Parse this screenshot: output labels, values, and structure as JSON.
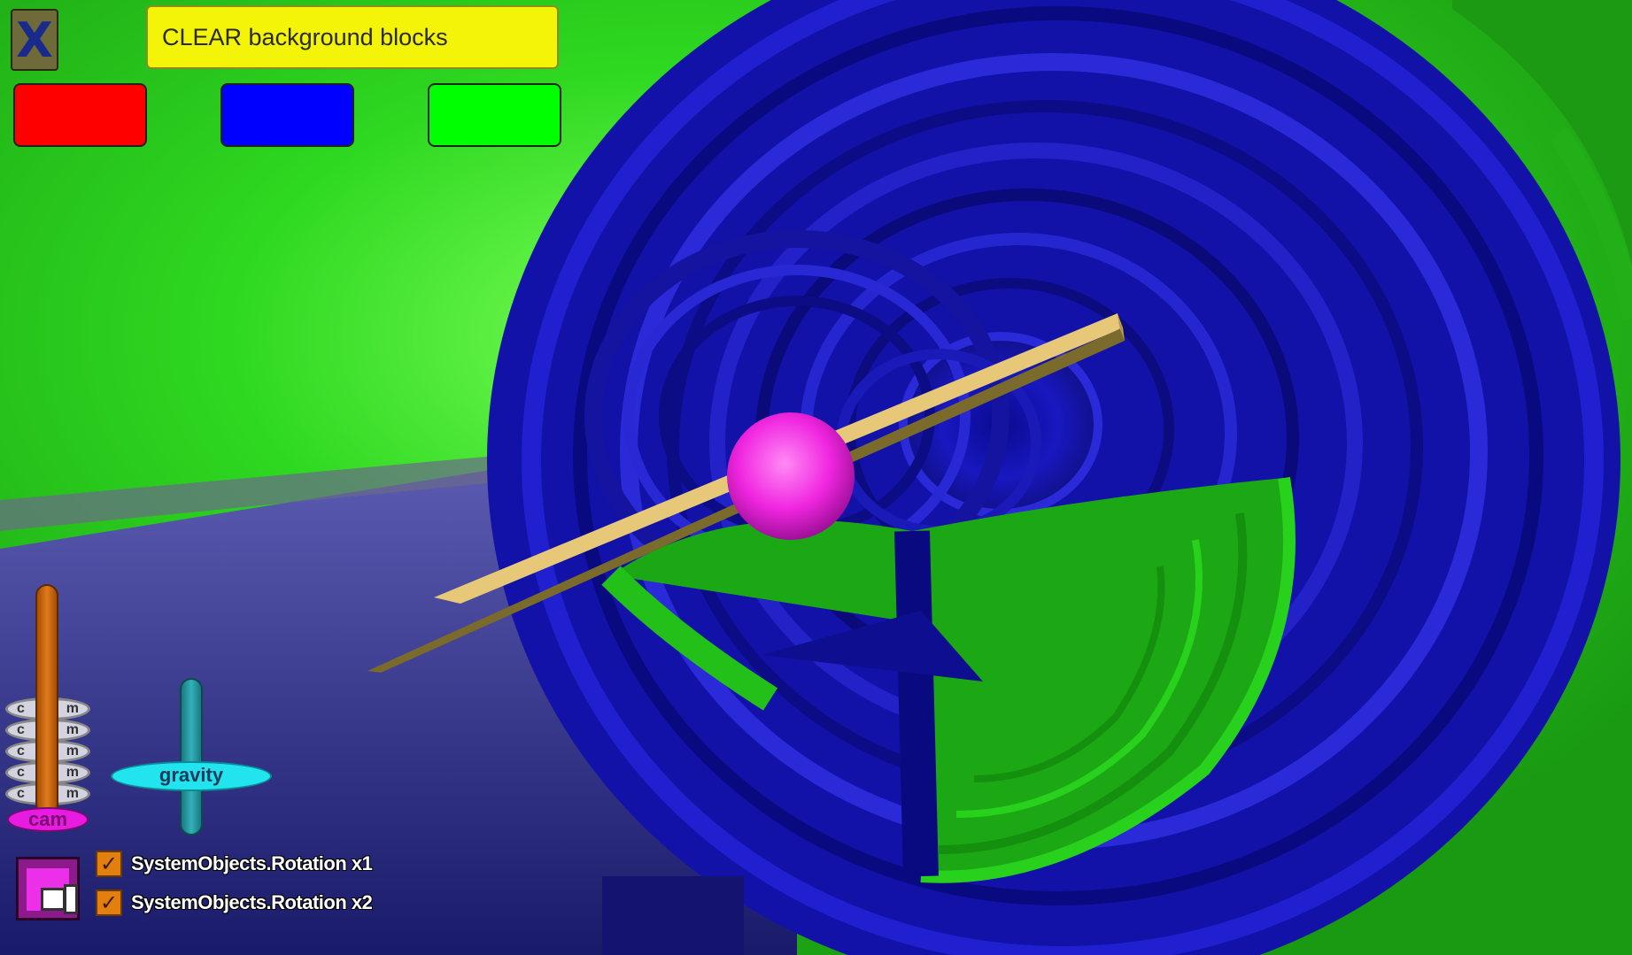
{
  "toolbar": {
    "close_label": "X",
    "clear_label": "CLEAR background blocks"
  },
  "swatches": [
    {
      "name": "red",
      "color": "#ff0000"
    },
    {
      "name": "blue",
      "color": "#0000ff"
    },
    {
      "name": "green",
      "color": "#00ff00"
    }
  ],
  "sliders": {
    "cam_label": "cam",
    "cam_ring_left": "c",
    "cam_ring_right": "m",
    "gravity_label": "gravity"
  },
  "checkboxes": [
    {
      "label": "SystemObjects.Rotation x1",
      "checked": true
    },
    {
      "label": "SystemObjects.Rotation x2",
      "checked": true
    }
  ],
  "colors": {
    "scene_green": "#22d418",
    "scene_blue": "#1a1ab8",
    "rod": "#c8a850",
    "sphere": "#ff2ae8"
  },
  "icons": [
    "close-icon",
    "layout-toggle-icon",
    "checkmark-icon"
  ]
}
